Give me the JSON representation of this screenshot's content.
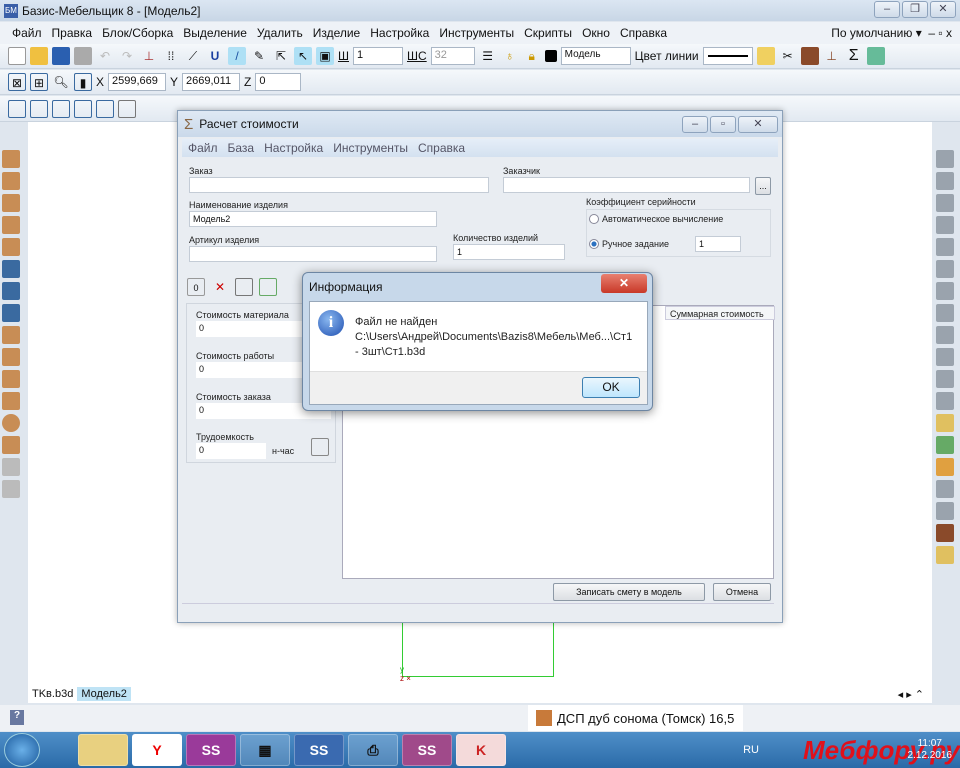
{
  "app": {
    "title": "Базис-Мебельщик 8 - [Модель2]",
    "icon_label": "БМ"
  },
  "menu": {
    "items": [
      "Файл",
      "Правка",
      "Блок/Сборка",
      "Выделение",
      "Удалить",
      "Изделие",
      "Настройка",
      "Инструменты",
      "Скрипты",
      "Окно",
      "Справка"
    ],
    "preset": "По умолчанию"
  },
  "toolbar": {
    "sh_label": "Ш",
    "sh_value": "1",
    "shs_label": "ШС",
    "shs_value": "32",
    "layer": "Модель",
    "line_color_label": "Цвет линии"
  },
  "coords": {
    "x_label": "X",
    "x": "2599,669",
    "y_label": "Y",
    "y": "2669,011",
    "z_label": "Z",
    "z": "0"
  },
  "cost_dialog": {
    "title": "Расчет стоимости",
    "menu": [
      "Файл",
      "База",
      "Настройка",
      "Инструменты",
      "Справка"
    ],
    "order_label": "Заказ",
    "order_value": "",
    "customer_label": "Заказчик",
    "customer_value": "",
    "browse": "...",
    "product_name_label": "Наименование изделия",
    "product_name": "Модель2",
    "article_label": "Артикул изделия",
    "article": "",
    "quantity_label": "Количество изделий",
    "quantity": "1",
    "series_label": "Коэффициент серийности",
    "auto_label": "Автоматическое вычисление",
    "manual_label": "Ручное задание",
    "manual_value": "1",
    "selected_mode": "manual",
    "material_cost_label": "Стоимость материала",
    "material_cost": "0",
    "work_cost_label": "Стоимость работы",
    "work_cost": "0",
    "order_cost_label": "Стоимость заказа",
    "order_cost": "0",
    "labor_label": "Трудоемкость",
    "labor": "0",
    "labor_unit": "н-час",
    "table_header_total": "Суммарная стоимость",
    "save_button": "Записать смету в модель",
    "cancel_button": "Отмена"
  },
  "info_dialog": {
    "title": "Информация",
    "line1": "Файл не найден",
    "line2": "C:\\Users\\Андрей\\Documents\\Bazis8\\Мебель\\Меб...\\Ст1",
    "line3": "- 3шт\\Ст1.b3d",
    "ok": "OK"
  },
  "tabs": [
    "TKв.b3d",
    "Модель2"
  ],
  "status": {
    "material": "ДСП дуб сонома (Томск) 16,5",
    "help": "?"
  },
  "taskbar": {
    "lang": "RU",
    "time": "11:07",
    "date": "2.12.2016",
    "watermark": "Мебфору.ру",
    "apps": [
      "explorer",
      "yandex",
      "bazis",
      "app",
      "bazis",
      "printer",
      "bazis",
      "pdf"
    ]
  },
  "colors": {
    "accent": "#3a78c0",
    "close_red": "#d9453a",
    "watermark": "#e0101a"
  }
}
